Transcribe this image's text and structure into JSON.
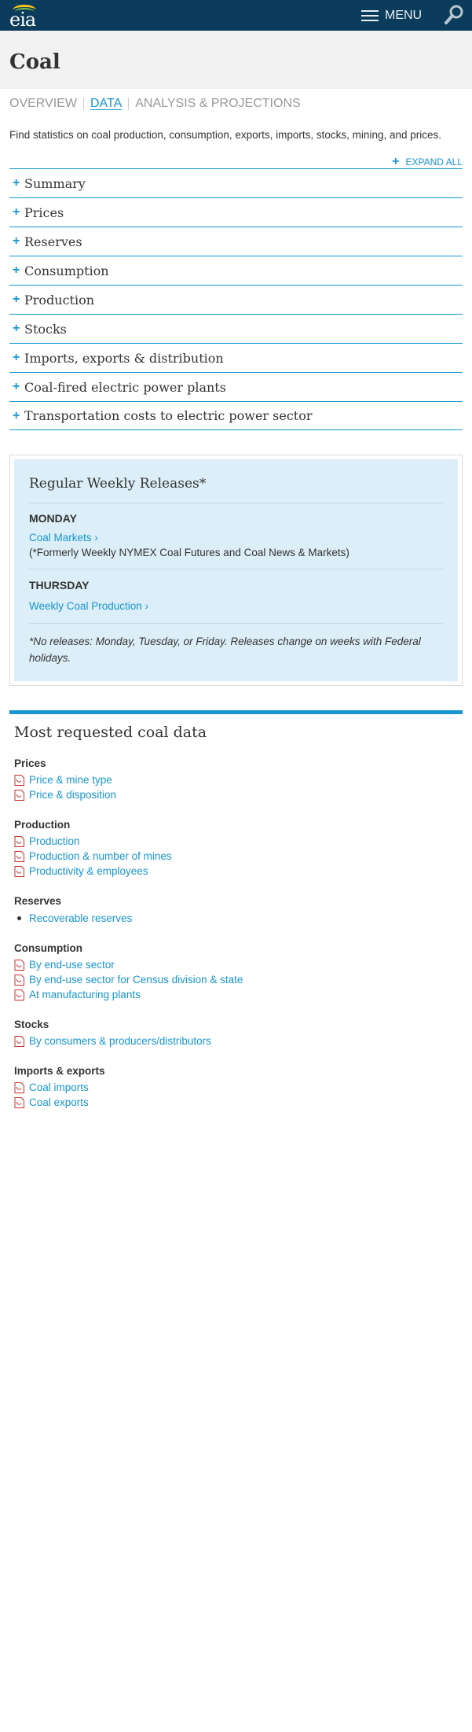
{
  "header": {
    "logo_text": "eia",
    "menu_label": "MENU"
  },
  "page": {
    "title": "Coal",
    "tabs": [
      {
        "label": "OVERVIEW",
        "active": false
      },
      {
        "label": "DATA",
        "active": true
      },
      {
        "label": "ANALYSIS & PROJECTIONS",
        "active": false
      }
    ],
    "intro": "Find statistics on coal production, consumption, exports, imports, stocks, mining, and prices.",
    "expand_all": "EXPAND ALL"
  },
  "accordion": [
    {
      "label": "Summary"
    },
    {
      "label": "Prices"
    },
    {
      "label": "Reserves"
    },
    {
      "label": "Consumption"
    },
    {
      "label": "Production"
    },
    {
      "label": "Stocks"
    },
    {
      "label": "Imports, exports & distribution"
    },
    {
      "label": "Coal-fired electric power plants"
    },
    {
      "label": "Transportation costs to electric power sector"
    }
  ],
  "weekly": {
    "title": "Regular Weekly Releases*",
    "monday": {
      "day": "MONDAY",
      "link": "Coal Markets ›",
      "note": "(*Formerly Weekly NYMEX Coal Futures and Coal News & Markets)"
    },
    "thursday": {
      "day": "THURSDAY",
      "link": "Weekly Coal Production ›"
    },
    "footnote": "*No releases: Monday, Tuesday, or Friday. Releases change on weeks with Federal holidays."
  },
  "most_requested": {
    "title": "Most requested coal data",
    "prices": {
      "heading": "Prices",
      "items": [
        "Price & mine type",
        "Price & disposition"
      ]
    },
    "production": {
      "heading": "Production",
      "items": [
        "Production",
        "Production & number of mines",
        "Productivity & employees"
      ]
    },
    "reserves": {
      "heading": "Reserves",
      "items": [
        "Recoverable reserves"
      ]
    },
    "consumption": {
      "heading": "Consumption",
      "items": [
        "By end-use sector",
        "By end-use sector for Census division & state",
        "At manufacturing plants"
      ]
    },
    "stocks": {
      "heading": "Stocks",
      "items": [
        "By consumers & producers/distributors"
      ]
    },
    "imports_exports": {
      "heading": "Imports & exports",
      "items": [
        "Coal imports",
        "Coal exports"
      ]
    }
  },
  "colors": {
    "header_bg": "#0c3c5b",
    "accent": "#1795d0",
    "panel_bg": "#dceef8"
  },
  "icons": {
    "search": "search-icon",
    "menu": "hamburger-icon",
    "pdf": "pdf-icon",
    "plus": "plus-icon"
  }
}
